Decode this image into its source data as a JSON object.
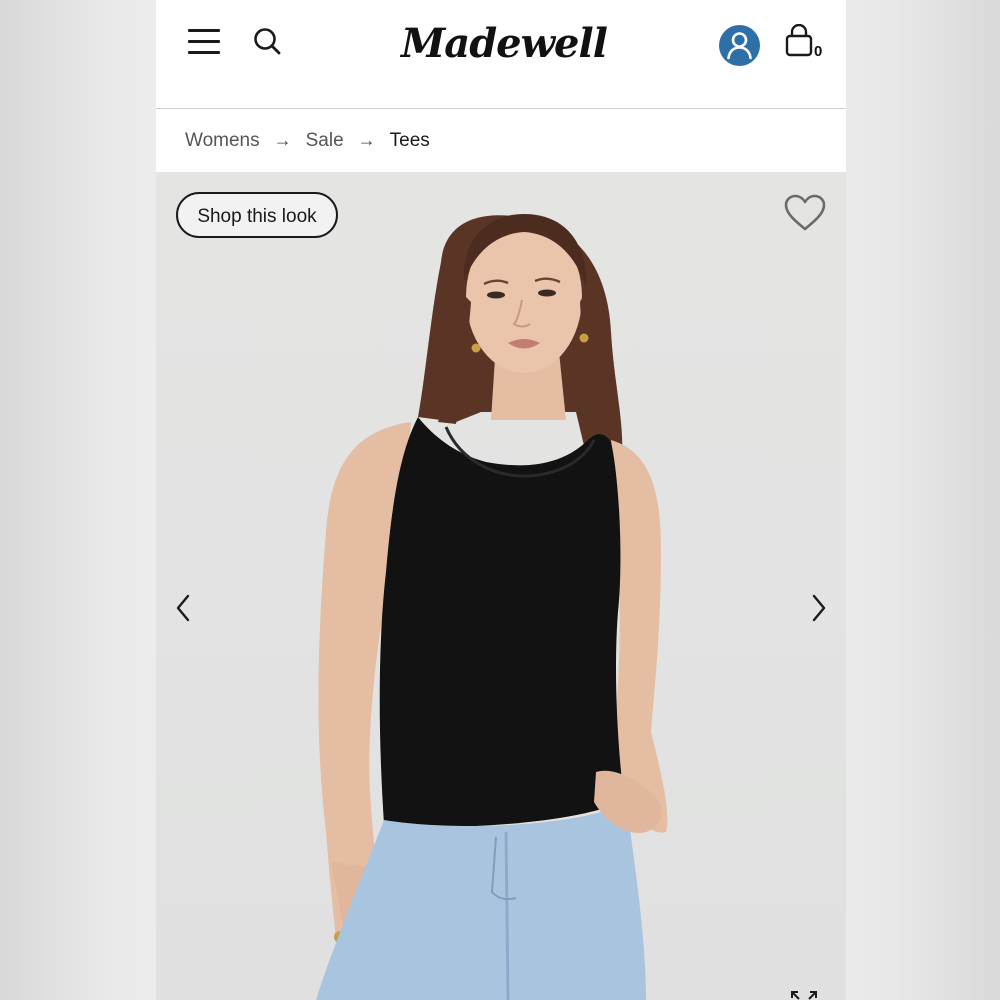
{
  "header": {
    "menu_icon": "hamburger-menu-icon",
    "search_icon": "search-icon",
    "logo_text": "Madewell",
    "account_icon": "user-account-icon",
    "account_color": "#2f6fa8",
    "bag_icon": "shopping-bag-icon",
    "bag_count": "0"
  },
  "breadcrumb": {
    "items": [
      "Womens",
      "Sale",
      "Tees"
    ],
    "separator": "→"
  },
  "hero": {
    "shop_look_label": "Shop this look",
    "favorite_icon": "heart-outline-icon",
    "prev_icon": "chevron-left-icon",
    "next_icon": "chevron-right-icon",
    "expand_icon": "expand-icon"
  }
}
